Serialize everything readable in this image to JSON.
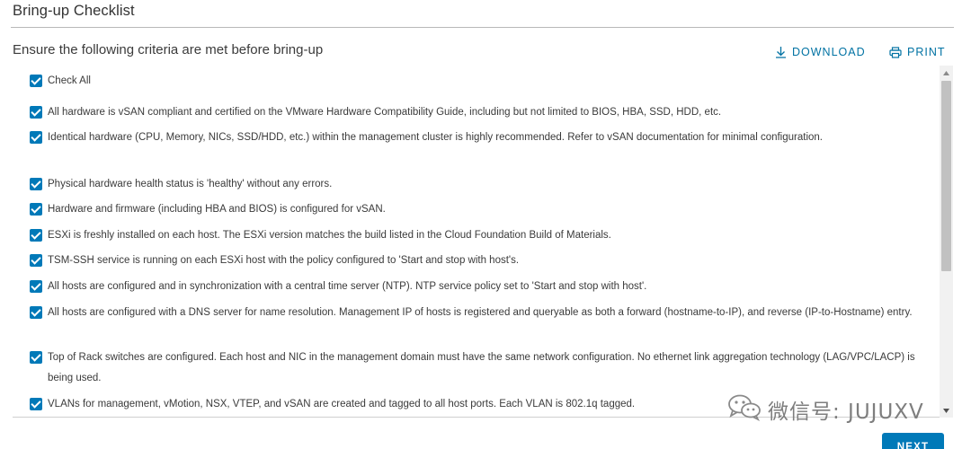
{
  "header": {
    "title": "Bring-up Checklist",
    "subtitle": "Ensure the following criteria are met before bring-up"
  },
  "actions": {
    "download_label": "DOWNLOAD",
    "print_label": "PRINT"
  },
  "checklist": {
    "items": [
      {
        "checked": true,
        "text": "Check All"
      },
      {
        "checked": true,
        "text": "All hardware is vSAN compliant and certified on the VMware Hardware Compatibility Guide, including but not limited to BIOS, HBA, SSD, HDD, etc."
      },
      {
        "checked": true,
        "text": "Identical hardware (CPU, Memory, NICs, SSD/HDD, etc.) within the management cluster is highly recommended. Refer to vSAN documentation for minimal configuration."
      },
      {
        "checked": true,
        "text": "Physical hardware health status is 'healthy' without any errors."
      },
      {
        "checked": true,
        "text": "Hardware and firmware (including HBA and BIOS) is configured for vSAN."
      },
      {
        "checked": true,
        "text": "ESXi is freshly installed on each host. The ESXi version matches the build listed in the Cloud Foundation Build of Materials."
      },
      {
        "checked": true,
        "text": "TSM-SSH service is running on each ESXi host with the policy configured to 'Start and stop with host's."
      },
      {
        "checked": true,
        "text": "All hosts are configured and in synchronization with a central time server (NTP). NTP service policy set to 'Start and stop with host'."
      },
      {
        "checked": true,
        "text": "All hosts are configured with a DNS server for name resolution. Management IP of hosts is registered and queryable as both a forward (hostname-to-IP), and reverse (IP-to-Hostname) entry."
      },
      {
        "checked": true,
        "text": "Top of Rack switches are configured. Each host and NIC in the management domain must have the same network configuration. No ethernet link aggregation technology (LAG/VPC/LACP) is being used."
      },
      {
        "checked": true,
        "text": "VLANs for management, vMotion, NSX, VTEP, and vSAN are created and tagged to all host ports. Each VLAN is 802.1q tagged."
      }
    ]
  },
  "watermark": {
    "text": "微信号: JUJUXV"
  },
  "footer": {
    "next_label": "NEXT"
  },
  "colors": {
    "accent": "#0079b8",
    "link": "#0072a3",
    "scroll_thumb": "#c1c1c1"
  }
}
